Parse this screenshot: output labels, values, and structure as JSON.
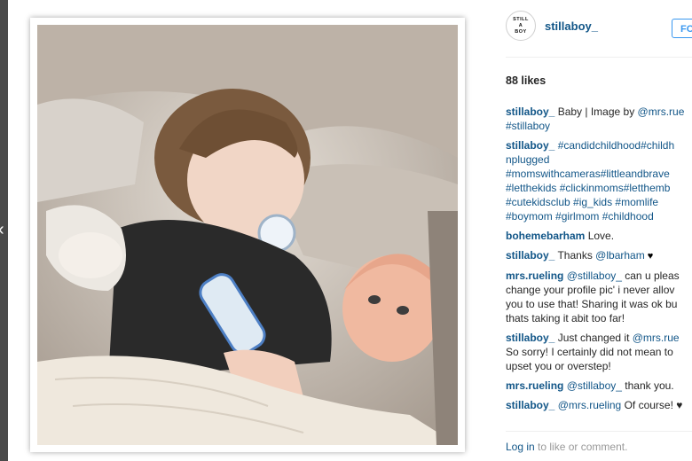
{
  "nav": {
    "prev_arrow": "‹"
  },
  "profile": {
    "avatar_lines": [
      "STILL",
      "A",
      "BOY"
    ],
    "username": "stillaboy_",
    "follow_label": "FO"
  },
  "likes": "88 likes",
  "comments": [
    {
      "lines": [
        [
          {
            "t": "stillaboy_",
            "k": "u"
          },
          {
            "t": " Baby | Image by ",
            "k": "text"
          },
          {
            "t": "@mrs.rue",
            "k": "link"
          }
        ],
        [
          {
            "t": "#stillaboy",
            "k": "link"
          }
        ]
      ]
    },
    {
      "lines": [
        [
          {
            "t": "stillaboy_",
            "k": "u"
          },
          {
            "t": " #candidchildhood#childh",
            "k": "link"
          }
        ],
        [
          {
            "t": "nplugged",
            "k": "link"
          }
        ],
        [
          {
            "t": "#momswithcameras#littleandbrave",
            "k": "link"
          }
        ],
        [
          {
            "t": "#letthekids #clickinmoms#letthemb",
            "k": "link"
          }
        ],
        [
          {
            "t": "#cutekidsclub #ig_kids #momlife",
            "k": "link"
          }
        ],
        [
          {
            "t": "#boymom #girlmom #childhood",
            "k": "link"
          }
        ]
      ]
    },
    {
      "lines": [
        [
          {
            "t": "bohemebarham",
            "k": "u"
          },
          {
            "t": " Love.",
            "k": "text"
          }
        ]
      ]
    },
    {
      "lines": [
        [
          {
            "t": "stillaboy_",
            "k": "u"
          },
          {
            "t": " Thanks ",
            "k": "text"
          },
          {
            "t": "@lbarham",
            "k": "link"
          },
          {
            "t": " ♥",
            "k": "heart"
          }
        ]
      ]
    },
    {
      "lines": [
        [
          {
            "t": "mrs.rueling",
            "k": "u"
          },
          {
            "t": " ",
            "k": "text"
          },
          {
            "t": "@stillaboy_",
            "k": "link"
          },
          {
            "t": " can u pleas",
            "k": "text"
          }
        ],
        [
          {
            "t": "change your profile pic' i never allov",
            "k": "text"
          }
        ],
        [
          {
            "t": "you to use that! Sharing it was ok bu",
            "k": "text"
          }
        ],
        [
          {
            "t": "thats taking it abit too far!",
            "k": "text"
          }
        ]
      ]
    },
    {
      "lines": [
        [
          {
            "t": "stillaboy_",
            "k": "u"
          },
          {
            "t": " Just changed it ",
            "k": "text"
          },
          {
            "t": "@mrs.rue",
            "k": "link"
          }
        ],
        [
          {
            "t": "So sorry! I certainly did not mean to",
            "k": "text"
          }
        ],
        [
          {
            "t": "upset you or overstep!",
            "k": "text"
          }
        ]
      ]
    },
    {
      "lines": [
        [
          {
            "t": "mrs.rueling",
            "k": "u"
          },
          {
            "t": " ",
            "k": "text"
          },
          {
            "t": "@stillaboy_",
            "k": "link"
          },
          {
            "t": " thank you.",
            "k": "text"
          }
        ]
      ]
    },
    {
      "lines": [
        [
          {
            "t": "stillaboy_",
            "k": "u"
          },
          {
            "t": " ",
            "k": "text"
          },
          {
            "t": "@mrs.rueling",
            "k": "link"
          },
          {
            "t": " Of course! ♥",
            "k": "text"
          }
        ]
      ]
    }
  ],
  "footer": {
    "login_link": "Log in",
    "rest": " to like or comment."
  },
  "colors": {
    "username": "#125688",
    "follow": "#3897f0",
    "meta": "#999999"
  }
}
